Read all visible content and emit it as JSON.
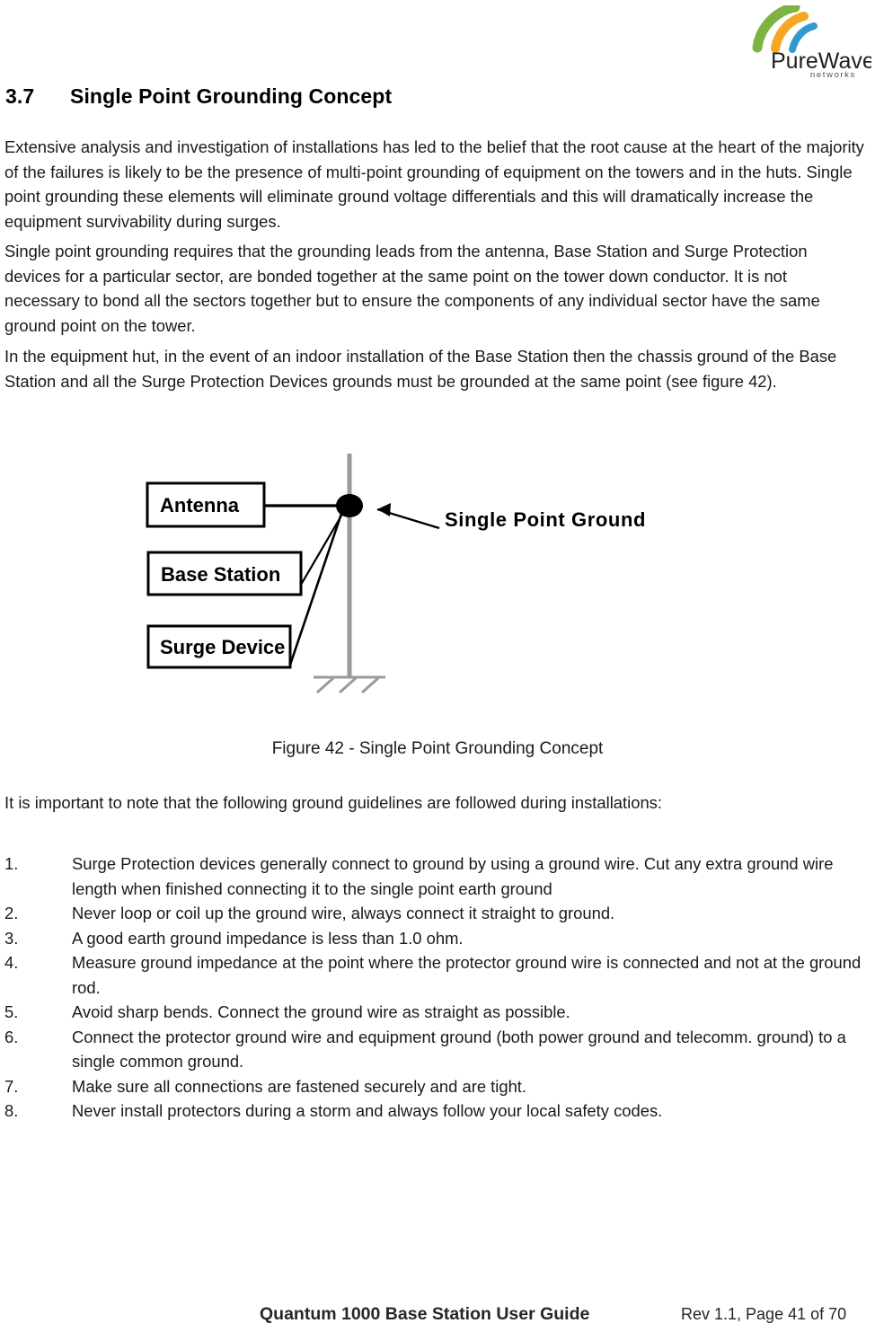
{
  "logo": {
    "wordmark": "PureWave",
    "tagline": "networks",
    "arc_colors": [
      "#7CB342",
      "#F5A623",
      "#3399CC"
    ],
    "text_color": "#231F20"
  },
  "heading": {
    "number": "3.7",
    "title": "Single Point Grounding Concept"
  },
  "paragraphs": {
    "p1": "Extensive analysis and investigation of installations has led to the belief that the root cause at the heart of the majority of the failures is likely to be the presence of multi-point grounding of equipment on the towers and in the huts. Single point grounding these elements will eliminate ground voltage differentials and this will dramatically increase the equipment survivability during surges.",
    "p2": "Single point grounding requires that the grounding leads from the antenna, Base Station and Surge Protection devices for a particular sector, are bonded together at the same point on the tower down conductor. It is not necessary to bond all the sectors together but to ensure the components of any individual sector have the same ground point on the tower.",
    "p3": "In the equipment hut, in the event of an indoor installation of the Base Station then the chassis ground of the Base Station and all the Surge Protection Devices grounds must be grounded at the same point (see figure 42).",
    "intro": "It is important to note that the following ground guidelines are followed during installations:"
  },
  "figure": {
    "caption": "Figure 42 - Single Point Grounding Concept",
    "boxes": [
      {
        "label": "Antenna"
      },
      {
        "label": "Base Station"
      },
      {
        "label": "Surge Device"
      }
    ],
    "callout": "Single Point Ground",
    "tower_color": "#9a9a9a",
    "node_color": "#000000"
  },
  "guidelines": [
    {
      "num": "1.",
      "text": "Surge Protection devices generally connect to ground by using a ground wire. Cut any extra ground wire length when finished connecting it to the single point earth ground"
    },
    {
      "num": "2.",
      "text": "Never loop or coil up the ground wire, always connect it straight to ground."
    },
    {
      "num": "3.",
      "text": "A good earth ground impedance is less than 1.0 ohm."
    },
    {
      "num": "4.",
      "text": "Measure ground impedance at the point where the protector ground wire is connected and not at the ground rod."
    },
    {
      "num": "5.",
      "text": "Avoid sharp bends. Connect the ground wire as straight as possible."
    },
    {
      "num": "6.",
      "text": "Connect the protector ground wire and equipment ground (both power ground and telecomm. ground) to a single common ground."
    },
    {
      "num": "7.",
      "text": "Make sure all connections are fastened securely and are tight."
    },
    {
      "num": "8.",
      "text": "Never install protectors during a storm and always follow your local safety codes."
    }
  ],
  "footer": {
    "left": "Quantum 1000 Base Station User Guide",
    "right": "Rev 1.1, Page 41 of 70"
  }
}
